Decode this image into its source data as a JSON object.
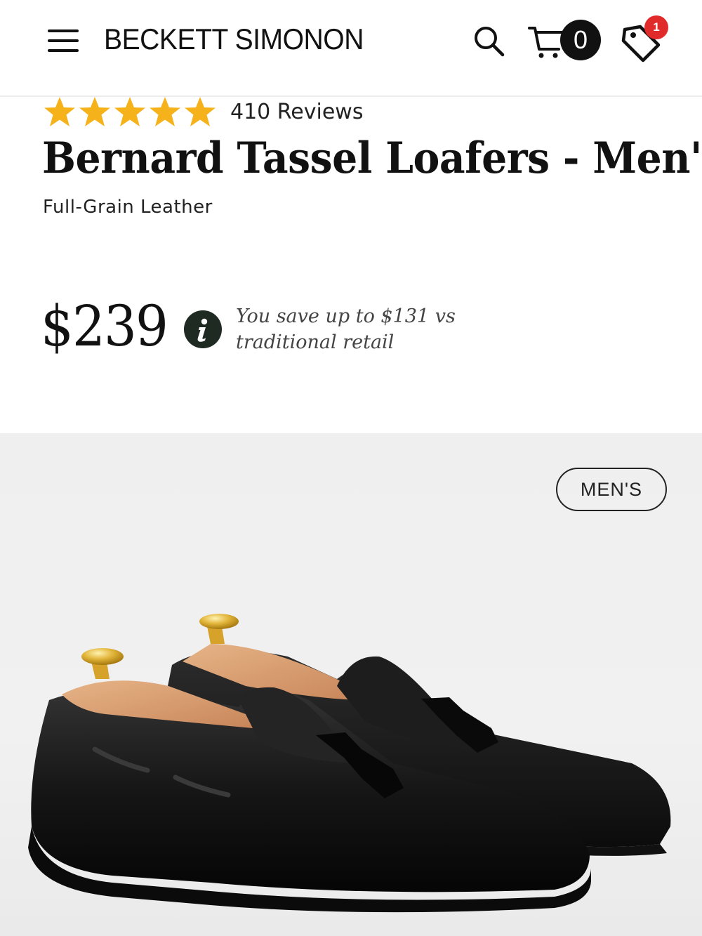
{
  "header": {
    "brand": "BECKETT SIMONON",
    "cart_count": "0",
    "wishlist_badge": "1",
    "icons": [
      "menu-icon",
      "search-icon",
      "cart-icon",
      "wishlist-tag-icon"
    ]
  },
  "product": {
    "rating": {
      "stars": 5,
      "reviews_label": "410 Reviews"
    },
    "title": "Bernard Tassel Loafers - Men's",
    "subtitle": "Full-Grain Leather",
    "price": "$239",
    "savings_line1": "You save up to $131 vs",
    "savings_line2": "traditional retail"
  },
  "gallery": {
    "tag": "MEN'S"
  },
  "colors": {
    "star": "#f5b21a",
    "badge": "#e12a2a",
    "info_button": "#1f2a23",
    "gallery_bg": "#efefef"
  }
}
